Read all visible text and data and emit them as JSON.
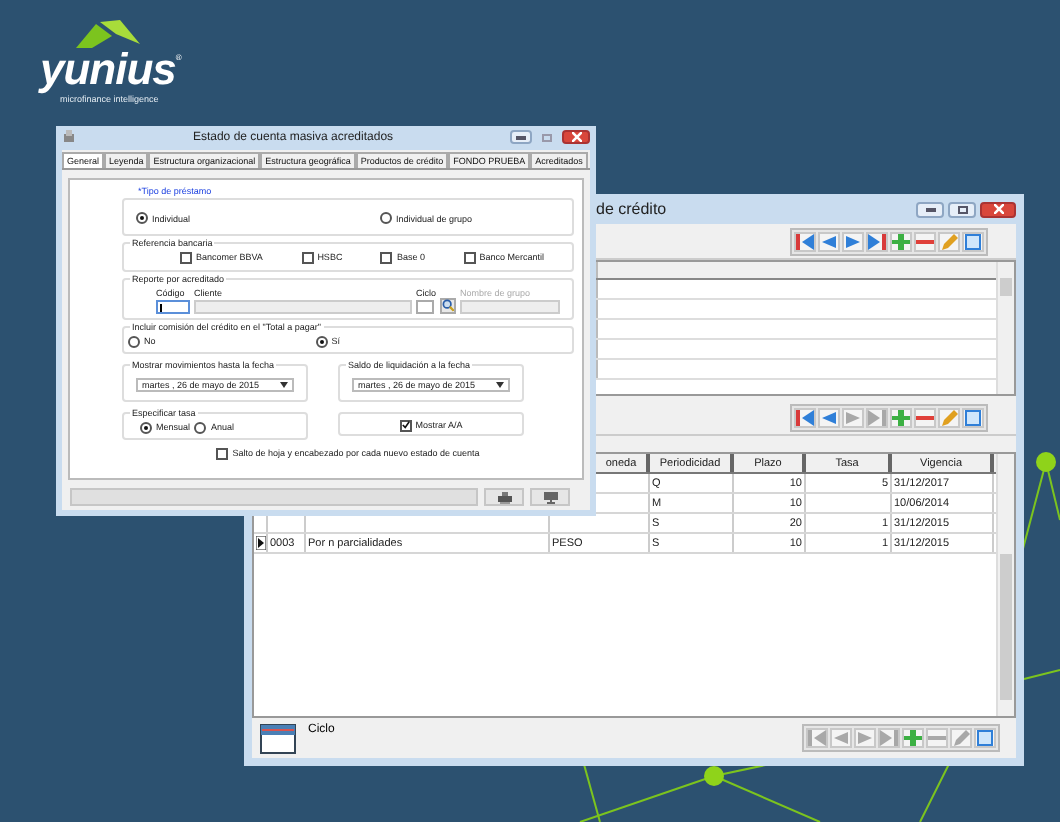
{
  "logo": {
    "wordmark": "yunius",
    "registered": "®",
    "tagline": "microfinance intelligence"
  },
  "back_window": {
    "title": "de crédito",
    "toolbars": [
      {
        "buttons": [
          {
            "kind": "first",
            "disabled": false
          },
          {
            "kind": "prev",
            "disabled": false
          },
          {
            "kind": "next",
            "disabled": false
          },
          {
            "kind": "last",
            "disabled": false
          },
          {
            "kind": "add",
            "disabled": false
          },
          {
            "kind": "remove",
            "disabled": false
          },
          {
            "kind": "edit",
            "disabled": false
          },
          {
            "kind": "save",
            "disabled": false
          }
        ]
      },
      {
        "buttons": [
          {
            "kind": "first",
            "disabled": false
          },
          {
            "kind": "prev",
            "disabled": false
          },
          {
            "kind": "next",
            "disabled": true
          },
          {
            "kind": "last",
            "disabled": true
          },
          {
            "kind": "add",
            "disabled": false
          },
          {
            "kind": "remove",
            "disabled": false
          },
          {
            "kind": "edit",
            "disabled": false
          },
          {
            "kind": "save",
            "disabled": false
          }
        ]
      },
      {
        "buttons": [
          {
            "kind": "first",
            "disabled": true
          },
          {
            "kind": "prev",
            "disabled": true
          },
          {
            "kind": "next",
            "disabled": true
          },
          {
            "kind": "last",
            "disabled": true
          },
          {
            "kind": "add",
            "disabled": false
          },
          {
            "kind": "remove",
            "disabled": true
          },
          {
            "kind": "edit",
            "disabled": true
          },
          {
            "kind": "save",
            "disabled": false
          }
        ]
      }
    ],
    "table": {
      "columns": [
        "oneda",
        "Periodicidad",
        "Plazo",
        "Tasa",
        "Vigencia"
      ],
      "rows": [
        {
          "current": false,
          "periodicidad": "Q",
          "plazo": "10",
          "tasa": "5",
          "vigencia": "31/12/2017"
        },
        {
          "current": false,
          "periodicidad": "M",
          "plazo": "10",
          "vigencia": "10/06/2014"
        },
        {
          "current": false,
          "periodicidad": "S",
          "plazo": "20",
          "tasa": "1",
          "vigencia": "31/12/2015"
        },
        {
          "current": true,
          "code": "0003",
          "description": "Por n parcialidades",
          "moneda": "PESO",
          "periodicidad": "S",
          "plazo": "10",
          "tasa": "1",
          "vigencia": "31/12/2015"
        }
      ]
    },
    "footer_label": "Ciclo"
  },
  "front_window": {
    "title": "Estado de cuenta masiva acreditados",
    "tabs": [
      {
        "label": "General",
        "selected": true
      },
      {
        "label": "Leyenda",
        "selected": false
      },
      {
        "label": "Estructura organizacional",
        "selected": false
      },
      {
        "label": "Estructura geográfica",
        "selected": false
      },
      {
        "label": "Productos de crédito",
        "selected": false
      },
      {
        "label": "FONDO PRUEBA",
        "selected": false
      },
      {
        "label": "Acreditados",
        "selected": false
      }
    ],
    "loan_type": {
      "label": "*Tipo de préstamo",
      "options": [
        {
          "label": "Individual",
          "selected": true
        },
        {
          "label": "Individual de grupo",
          "selected": false
        }
      ]
    },
    "bank_reference": {
      "label": "Referencia bancaria",
      "options": [
        {
          "label": "Bancomer BBVA",
          "checked": false
        },
        {
          "label": "HSBC",
          "checked": false
        },
        {
          "label": "Base 0",
          "checked": false
        },
        {
          "label": "Banco Mercantil",
          "checked": false
        }
      ]
    },
    "report": {
      "label": "Reporte por acreditado",
      "code_label": "Código",
      "client_label": "Cliente",
      "cycle_label": "Ciclo",
      "group_label": "Nombre de grupo"
    },
    "commission": {
      "label": "Incluir comisión del crédito en el \"Total a pagar\"",
      "options": [
        {
          "label": "No",
          "selected": false
        },
        {
          "label": "Sí",
          "selected": true
        }
      ]
    },
    "movements_until": {
      "label": "Mostrar movimientos hasta la fecha",
      "value": "martes , 26 de mayo de 2015"
    },
    "settlement": {
      "label": "Saldo de liquidación a la fecha",
      "value": "martes , 26 de mayo de 2015"
    },
    "rate": {
      "label": "Especificar tasa",
      "options": [
        {
          "label": "Mensual",
          "selected": true
        },
        {
          "label": "Anual",
          "selected": false
        }
      ]
    },
    "show_aa": {
      "label": "Mostrar A/A",
      "checked": true
    },
    "page_break": {
      "label": "Salto de hoja y encabezado por cada nuevo estado de cuenta",
      "checked": false
    }
  }
}
